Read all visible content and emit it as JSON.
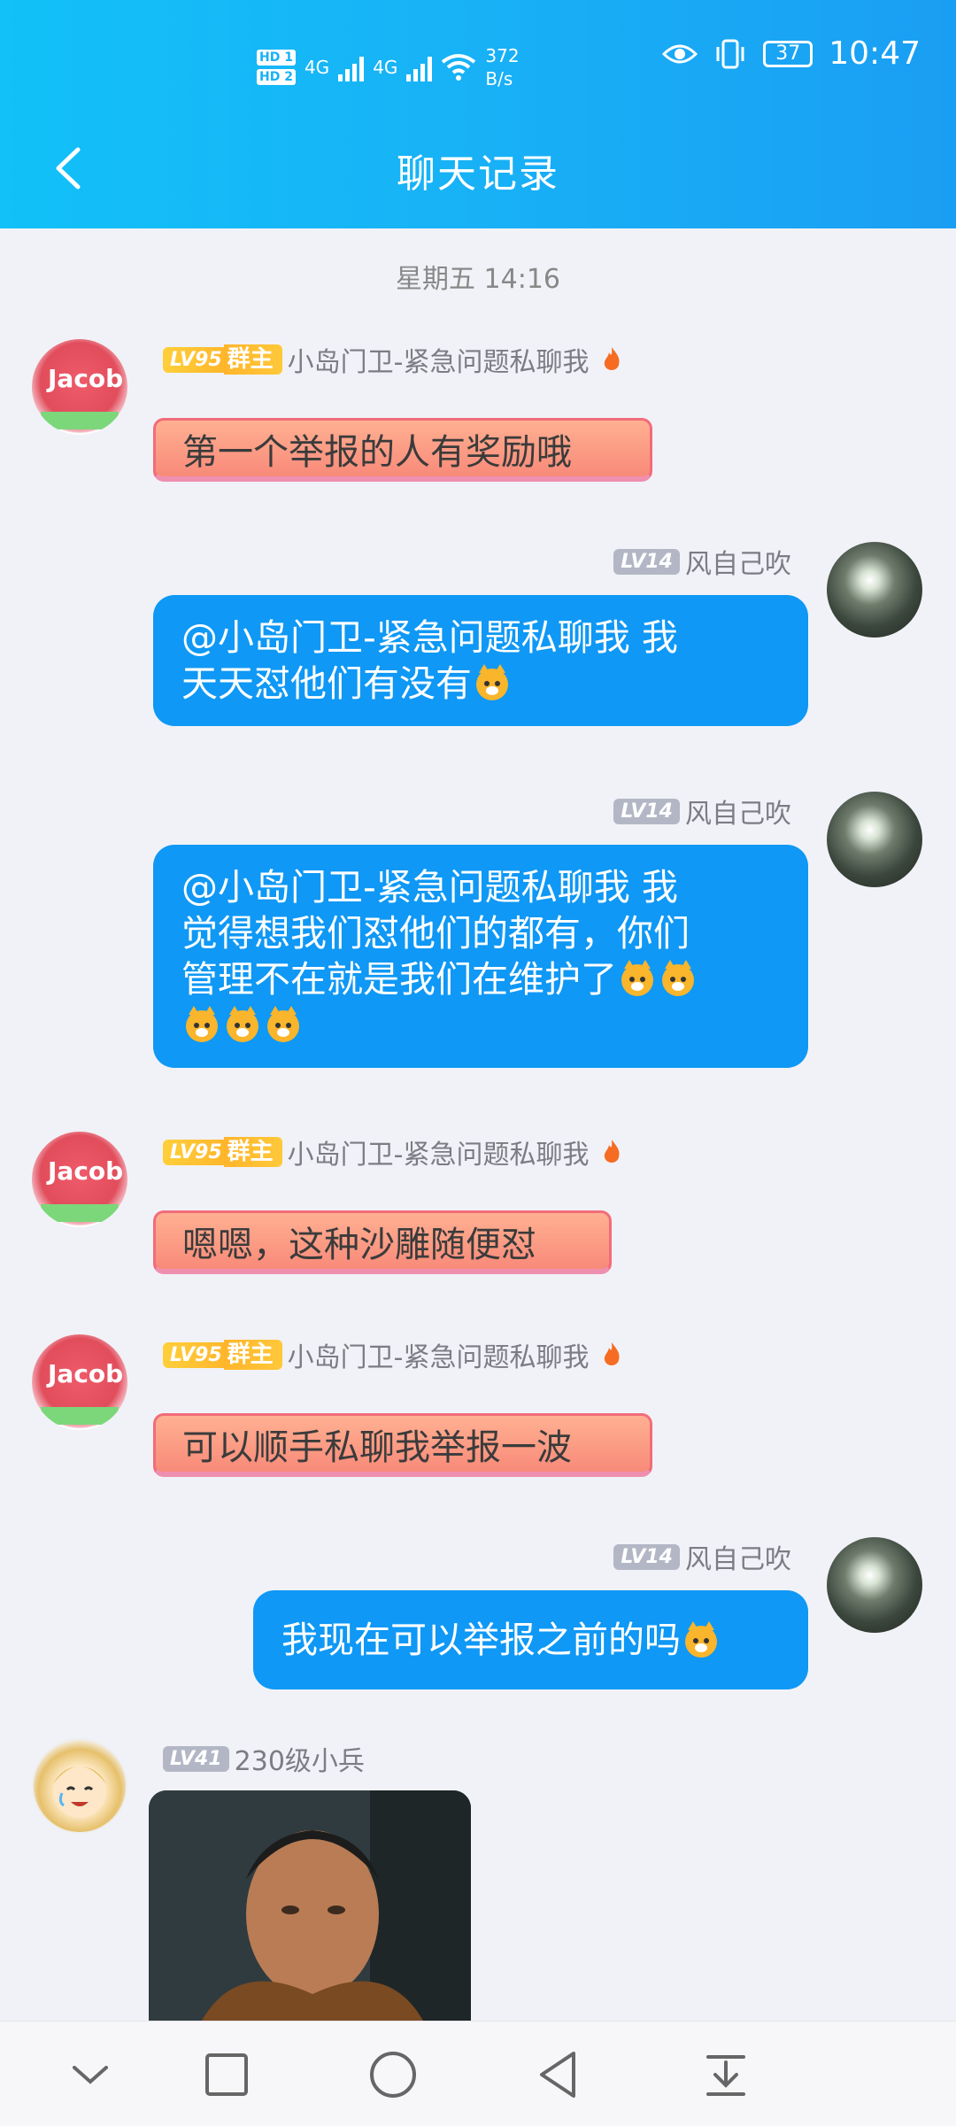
{
  "status_bar": {
    "hd1": "HD 1",
    "hd2": "HD 2",
    "net1": "4G",
    "net2": "4G",
    "speed_value": "372",
    "speed_unit": "B/s",
    "battery": "37",
    "time": "10:47"
  },
  "header": {
    "title": "聊天记录",
    "back_icon": "chevron-left-icon"
  },
  "timestamp": "星期五 14:16",
  "messages": [
    {
      "level": "LV95",
      "role": "群主",
      "nick": "小岛门卫-紧急问题私聊我",
      "text": "第一个举报的人有奖励哦"
    },
    {
      "level": "LV14",
      "nick": "风自己吹",
      "line1": "@小岛门卫-紧急问题私聊我 我",
      "line2": "天天怼他们有没有"
    },
    {
      "level": "LV14",
      "nick": "风自己吹",
      "line1": "@小岛门卫-紧急问题私聊我 我",
      "line2": "觉得想我们怼他们的都有，你们",
      "line3": "管理不在就是我们在维护了"
    },
    {
      "level": "LV95",
      "role": "群主",
      "nick": "小岛门卫-紧急问题私聊我",
      "text": "嗯嗯，这种沙雕随便怼"
    },
    {
      "level": "LV95",
      "role": "群主",
      "nick": "小岛门卫-紧急问题私聊我",
      "text": "可以顺手私聊我举报一波"
    },
    {
      "level": "LV14",
      "nick": "风自己吹",
      "text": "我现在可以举报之前的吗"
    },
    {
      "level": "LV41",
      "nick": "230级小兵"
    }
  ],
  "avatar_text": "Jacob",
  "colors": {
    "header_start": "#12c1f8",
    "header_end": "#1a9ef3",
    "bubble_blue": "#0f98f5",
    "bubble_red": "#f88a79",
    "background": "#f1f2f7"
  },
  "nav_icons": [
    "chevron-down-icon",
    "square-icon",
    "circle-icon",
    "triangle-back-icon",
    "download-tray-icon"
  ]
}
